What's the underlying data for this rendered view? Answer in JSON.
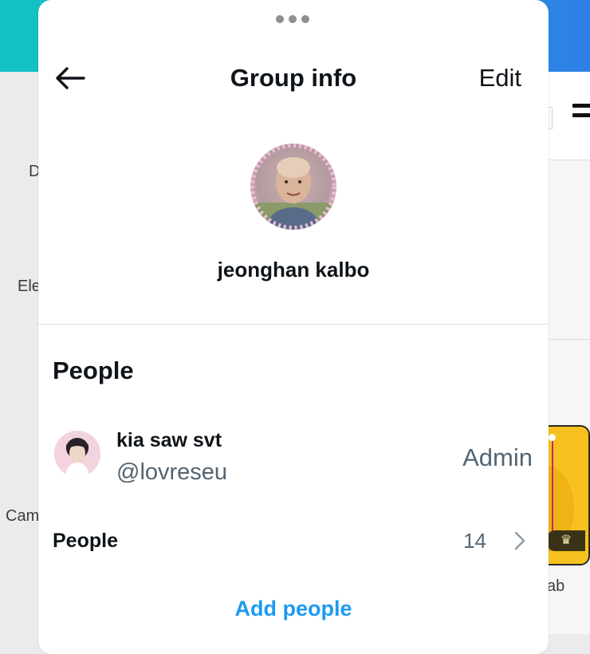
{
  "header": {
    "title": "Group info",
    "edit_label": "Edit",
    "back_icon": "arrow-left-icon"
  },
  "group": {
    "name": "jeonghan kalbo"
  },
  "people_section": {
    "title": "People",
    "members": [
      {
        "name": "kia saw svt",
        "handle": "@lovreseu",
        "role": "Admin"
      }
    ],
    "people_row": {
      "label": "People",
      "count": "14"
    },
    "add_label": "Add people"
  },
  "background": {
    "labels": [
      "D",
      "Ele",
      "Cam",
      "ab"
    ]
  },
  "colors": {
    "accent": "#1d9bf0",
    "primary_text": "#0f1419",
    "secondary_text": "#536471"
  }
}
